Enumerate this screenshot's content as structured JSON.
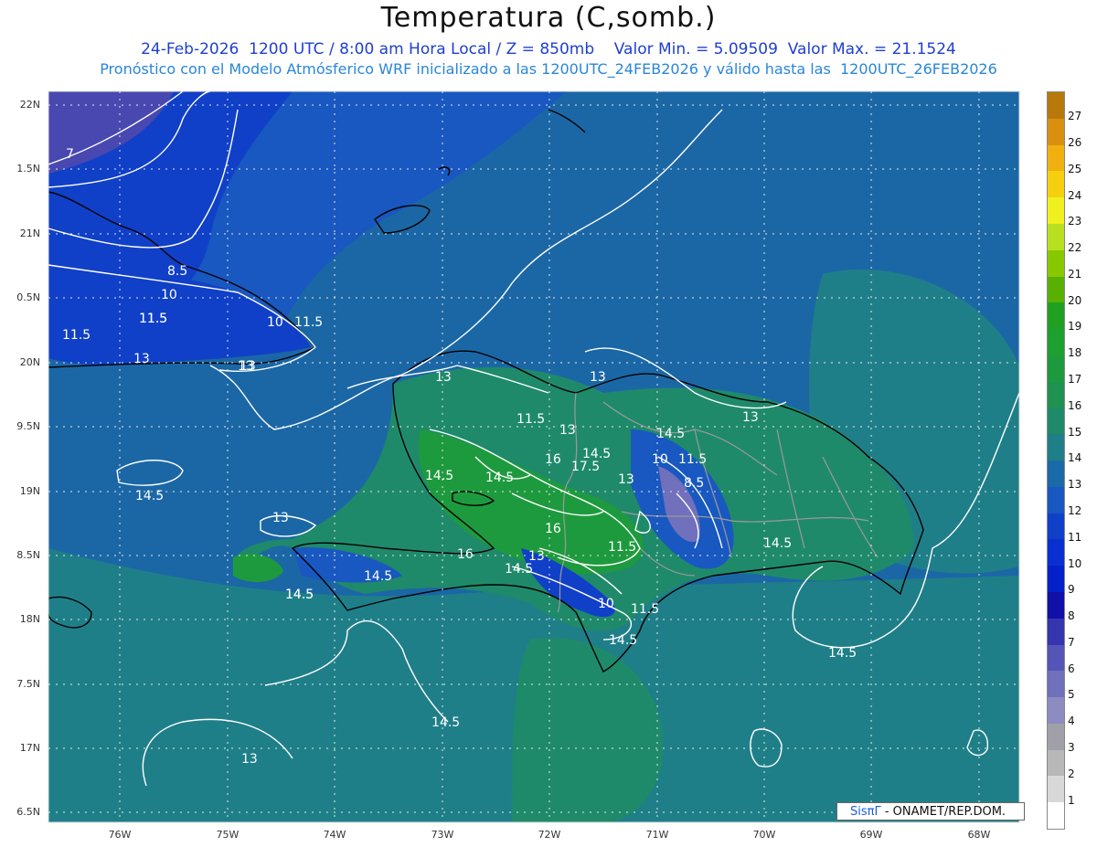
{
  "header": {
    "title": "Temperatura (C,somb.)",
    "line1": "24-Feb-2026  1200 UTC / 8:00 am Hora Local / Z = 850mb    Valor Min. = 5.09509  Valor Max. = 21.1524",
    "line2": "Pronóstico con el Modelo Atmósferico WRF inicializado a las 1200UTC_24FEB2026 y válido hasta las  1200UTC_26FEB2026"
  },
  "map": {
    "lat_labels": [
      "22N",
      "1.5N",
      "21N",
      "0.5N",
      "20N",
      "9.5N",
      "19N",
      "8.5N",
      "18N",
      "7.5N",
      "17N",
      "6.5N"
    ],
    "lon_labels": [
      "76W",
      "75W",
      "74W",
      "73W",
      "72W",
      "71W",
      "70W",
      "69W",
      "68W"
    ],
    "contour_labels": [
      "7",
      "8.5",
      "10",
      "11.5",
      "11.5",
      "10",
      "11.5",
      "11.5",
      "13",
      "13",
      "13",
      "13",
      "13",
      "11.5",
      "13",
      "14.5",
      "10",
      "11.5",
      "8.5",
      "14.5",
      "16",
      "17.5",
      "14.5",
      "14.5",
      "13",
      "16",
      "11.5",
      "14.5",
      "16",
      "13",
      "14.5",
      "10",
      "11.5",
      "14.5",
      "14.5",
      "13",
      "14.5",
      "14.5",
      "14.5",
      "14.5",
      "13",
      "14.5",
      "13"
    ]
  },
  "colorbar": {
    "levels": [
      "27",
      "26",
      "25",
      "24",
      "23",
      "22",
      "21",
      "20",
      "19",
      "18",
      "17",
      "16",
      "15",
      "14",
      "13",
      "12",
      "11",
      "10",
      "9",
      "8",
      "7",
      "6",
      "5",
      "4",
      "3",
      "2",
      "1"
    ],
    "colors": [
      "#b8780a",
      "#d99010",
      "#f0b010",
      "#f5d010",
      "#f0f020",
      "#b8e020",
      "#88c800",
      "#58b000",
      "#20a020",
      "#1da030",
      "#1e9a3e",
      "#1f9250",
      "#1f8a6a",
      "#1f7f88",
      "#1b6aa8",
      "#1858c0",
      "#1040c8",
      "#0a2fd0",
      "#0420c8",
      "#1010a8",
      "#3535b0",
      "#5555b8",
      "#7070bc",
      "#8c8cc0",
      "#a0a0a8",
      "#b8b8b8",
      "#d8d8d8",
      "#ffffff"
    ]
  },
  "credit": {
    "logo": "SisπΓ",
    "text": "- ONAMET/REP.DOM."
  }
}
